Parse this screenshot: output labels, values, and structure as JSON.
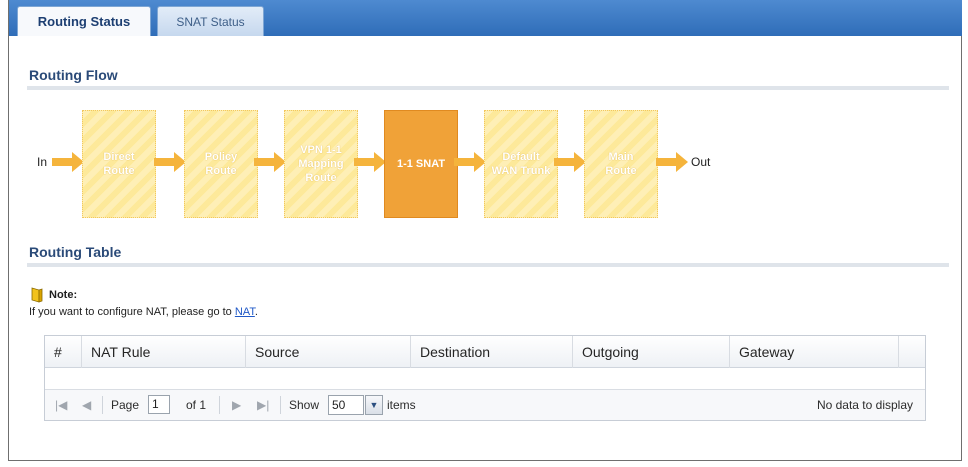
{
  "tabs": [
    {
      "label": "Routing Status",
      "active": true
    },
    {
      "label": "SNAT Status",
      "active": false
    }
  ],
  "routing_flow": {
    "title": "Routing Flow",
    "in_label": "In",
    "out_label": "Out",
    "steps": [
      {
        "lines": [
          "Direct",
          "Route"
        ],
        "active": false
      },
      {
        "lines": [
          "Policy",
          "Route"
        ],
        "active": false
      },
      {
        "lines": [
          "VPN 1-1",
          "Mapping",
          "Route"
        ],
        "active": false
      },
      {
        "lines": [
          "1-1 SNAT"
        ],
        "active": true
      },
      {
        "lines": [
          "Default",
          "WAN Trunk"
        ],
        "active": false
      },
      {
        "lines": [
          "Main",
          "Route"
        ],
        "active": false
      }
    ]
  },
  "routing_table": {
    "title": "Routing Table",
    "note_label": "Note:",
    "note_text": "If you want to configure NAT, please go to ",
    "note_link": "NAT",
    "note_suffix": ".",
    "columns": [
      "#",
      "NAT Rule",
      "Source",
      "Destination",
      "Outgoing",
      "Gateway"
    ],
    "rows": [],
    "pager": {
      "page_label": "Page",
      "page_value": "1",
      "of_label": "of 1",
      "show_label": "Show",
      "show_value": "50",
      "items_label": "items",
      "empty_text": "No data to display"
    }
  },
  "colors": {
    "accent": "#2f6db8",
    "flow_box": "#fde99a",
    "flow_box_active": "#f0a238",
    "arrow": "#f5b43c"
  }
}
